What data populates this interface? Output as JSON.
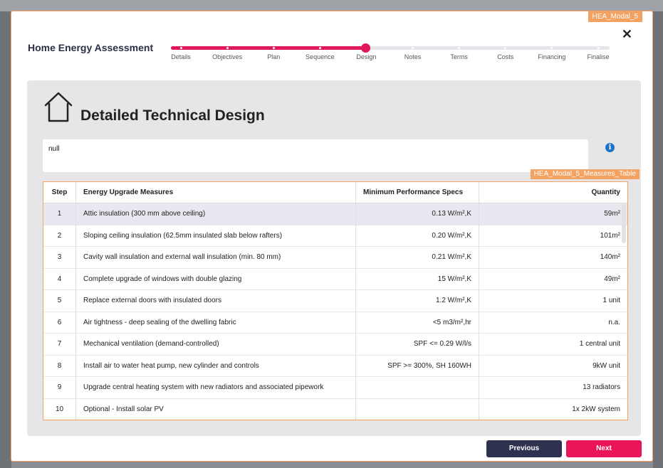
{
  "modal": {
    "tag": "HEA_Modal_5",
    "title": "Home Energy Assessment",
    "close_label": "✕"
  },
  "stepper": {
    "steps": [
      "Details",
      "Objectives",
      "Plan",
      "Sequence",
      "Design",
      "Notes",
      "Terms",
      "Costs",
      "Financing",
      "Finalise"
    ],
    "current": "Design",
    "accent_color": "#e0195a"
  },
  "content": {
    "title": "Detailed Technical Design",
    "icon": "house-icon",
    "notes_value": "null",
    "info_icon": "i"
  },
  "measures_table": {
    "tag": "HEA_Modal_5_Measures_Table",
    "headers": {
      "step": "Step",
      "measure": "Energy Upgrade Measures",
      "spec": "Minimum Performance Specs",
      "quantity": "Quantity"
    },
    "rows": [
      {
        "step": "1",
        "measure": "Attic insulation (300 mm above ceiling)",
        "spec": "0.13 W/m²,K",
        "quantity": "59m²"
      },
      {
        "step": "2",
        "measure": "Sloping ceiling insulation (62.5mm insulated slab below rafters)",
        "spec": "0.20 W/m²,K",
        "quantity": "101m²"
      },
      {
        "step": "3",
        "measure": "Cavity wall insulation and external wall insulation (min. 80 mm)",
        "spec": "0.21 W/m²,K",
        "quantity": "140m²"
      },
      {
        "step": "4",
        "measure": "Complete upgrade of windows with double glazing",
        "spec": "15 W/m²,K",
        "quantity": "49m²"
      },
      {
        "step": "5",
        "measure": "Replace external doors with insulated doors",
        "spec": "1.2 W/m²,K",
        "quantity": "1 unit"
      },
      {
        "step": "6",
        "measure": "Air tightness - deep sealing of the dwelling fabric",
        "spec": "<5 m3/m²,hr",
        "quantity": "n.a."
      },
      {
        "step": "7",
        "measure": "Mechanical ventilation (demand-controlled)",
        "spec": "SPF <= 0.29 W/l/s",
        "quantity": "1 central unit"
      },
      {
        "step": "8",
        "measure": "Install air to water heat pump, new cylinder and controls",
        "spec": "SPF >= 300%, SH 160WH",
        "quantity": "9kW unit"
      },
      {
        "step": "9",
        "measure": "Upgrade central heating system with new radiators and associated pipework",
        "spec": "",
        "quantity": "13 radiators"
      },
      {
        "step": "10",
        "measure": "Optional - Install solar PV",
        "spec": "",
        "quantity": "1x 2kW system"
      }
    ]
  },
  "footer": {
    "previous_label": "Previous",
    "next_label": "Next"
  }
}
